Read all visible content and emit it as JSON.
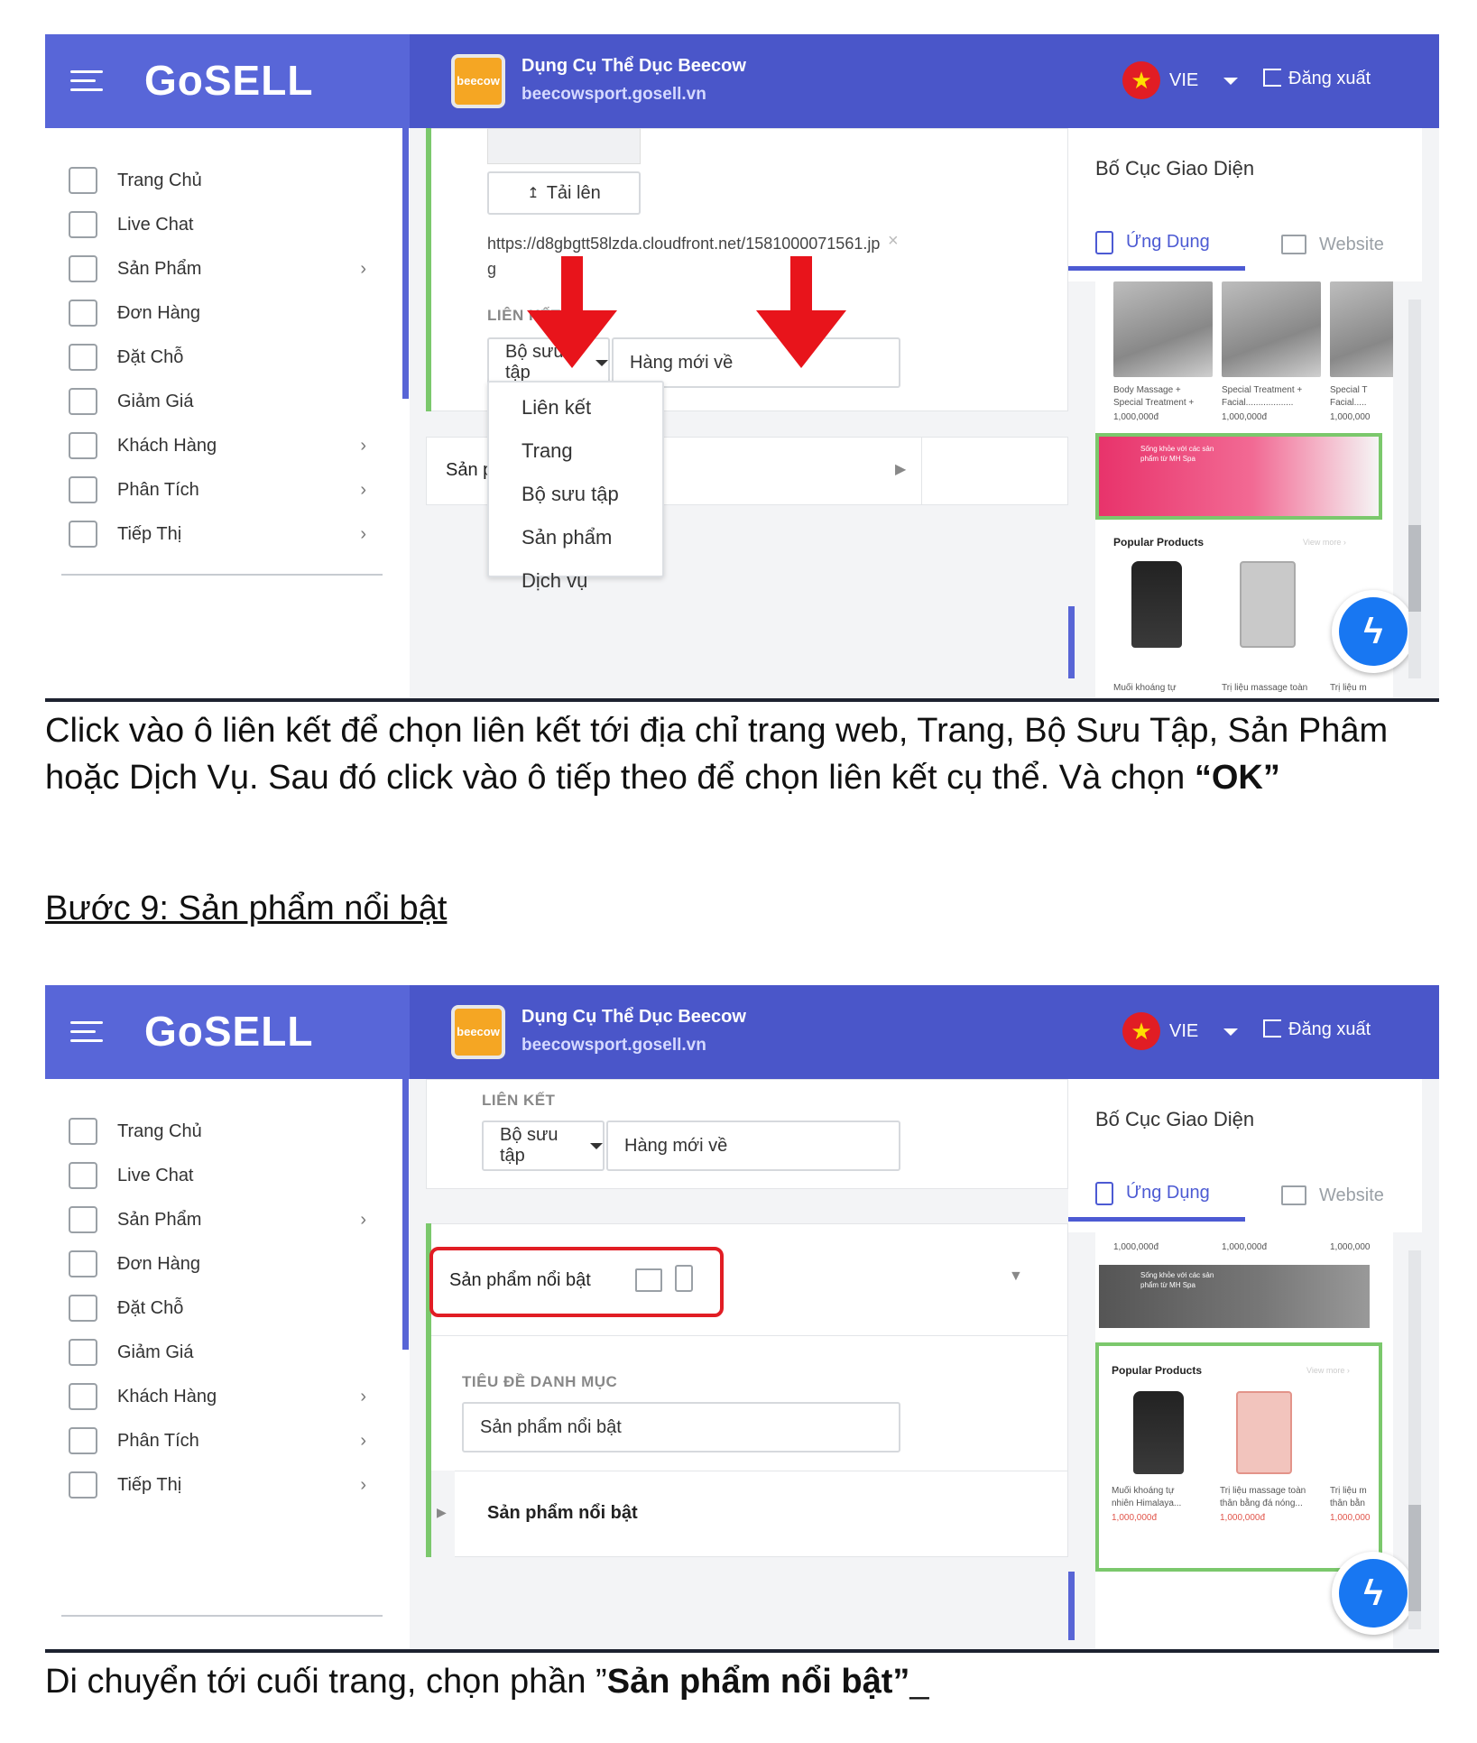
{
  "header": {
    "logo": "GoSELL",
    "store_name": "Dụng Cụ Thể Dục Beecow",
    "store_url": "beecowsport.gosell.vn",
    "store_thumb": "beecow",
    "language": "VIE",
    "logout": "Đăng xuất"
  },
  "sidebar": {
    "items": [
      {
        "label": "Trang Chủ",
        "icon": "home-icon",
        "chevron": false
      },
      {
        "label": "Live Chat",
        "icon": "chat-icon",
        "chevron": false
      },
      {
        "label": "Sản Phẩm",
        "icon": "tag-icon",
        "chevron": true
      },
      {
        "label": "Đơn Hàng",
        "icon": "receipt-icon",
        "chevron": false
      },
      {
        "label": "Đặt Chỗ",
        "icon": "calendar-check-icon",
        "chevron": false
      },
      {
        "label": "Giảm Giá",
        "icon": "discount-icon",
        "chevron": false
      },
      {
        "label": "Khách Hàng",
        "icon": "users-icon",
        "chevron": true
      },
      {
        "label": "Phân Tích",
        "icon": "chart-icon",
        "chevron": true
      },
      {
        "label": "Tiếp Thị",
        "icon": "bulb-icon",
        "chevron": true
      }
    ]
  },
  "layout_panel": {
    "title": "Bố Cục Giao Diện",
    "tab_app": "Ứng Dụng",
    "tab_web": "Website"
  },
  "shot1": {
    "upload_button": "Tải lên",
    "image_url_line1": "https://d8gbgtt58lzda.cloudfront.net/1581000071561.jp",
    "image_url_line2": "g",
    "link_label": "LIÊN KẾT",
    "link_type": "Bộ sưu tập",
    "link_target": "Hàng mới về",
    "link_options": [
      "Liên kết",
      "Trang",
      "Bộ sưu tập",
      "Sản phẩm",
      "Dịch vụ"
    ],
    "collapsed_section": "Sản ph",
    "preview": {
      "products": [
        {
          "name1": "Body Massage +",
          "name2": "Special Treatment +",
          "price": "1,000,000đ"
        },
        {
          "name1": "Special Treatment +",
          "name2": "Facial...................",
          "price": "1,000,000đ"
        },
        {
          "name1": "Special T",
          "name2": "Facial.....",
          "price": "1,000,000"
        }
      ],
      "banner_text": "Sống khỏe với các sản phẩm từ MH Spa",
      "popular": "Popular Products",
      "view_more": "View more ›",
      "popular_items": [
        "Muối khoáng tự",
        "Trị liệu massage toàn",
        "Trị liệu m"
      ]
    }
  },
  "shot2": {
    "link_label": "LIÊN KẾT",
    "link_type": "Bộ sưu tập",
    "link_target": "Hàng mới về",
    "section_name": "Sản phẩm nổi bật",
    "category_title_label": "TIÊU ĐỀ DANH MỤC",
    "category_title_value": "Sản phẩm nổi bật",
    "sub_section": "Sản phẩm nổi bật",
    "preview": {
      "prices": [
        "1,000,000đ",
        "1,000,000đ",
        "1,000,000"
      ],
      "banner_text": "Sống khỏe với các sản phẩm từ MH Spa",
      "popular": "Popular Products",
      "view_more": "View more ›",
      "items": [
        {
          "n1": "Muối khoáng tự",
          "n2": "nhiên Himalaya...",
          "p": "1,000,000đ"
        },
        {
          "n1": "Trị liệu massage toàn",
          "n2": "thân bằng đá nóng...",
          "p": "1,000,000đ"
        },
        {
          "n1": "Trị liệu m",
          "n2": "thân bằn",
          "p": "1,000,000"
        }
      ]
    }
  },
  "doc": {
    "caption1_line1": "Click vào ô liên kết để chọn liên kết tới địa chỉ trang web, Trang, Bộ Sưu Tập, Sản Phâm",
    "caption1_line2_pre": "hoặc Dịch Vụ. Sau đó click vào ô tiếp theo để chọn liên kết cụ thể. Và chọn ",
    "caption1_bold": "“OK”",
    "step_heading": "Bước 9: Sản phẩm nổi bật ",
    "caption2_pre": "Di chuyển tới cuối trang, chọn phần ”",
    "caption2_bold": "Sản phẩm nổi bật”",
    "caption2_post": "_"
  },
  "colors": {
    "brand": "#5865d6",
    "accent_green": "#7bc86c",
    "arrow_red": "#e8141b",
    "highlight_red": "#e11d24"
  }
}
